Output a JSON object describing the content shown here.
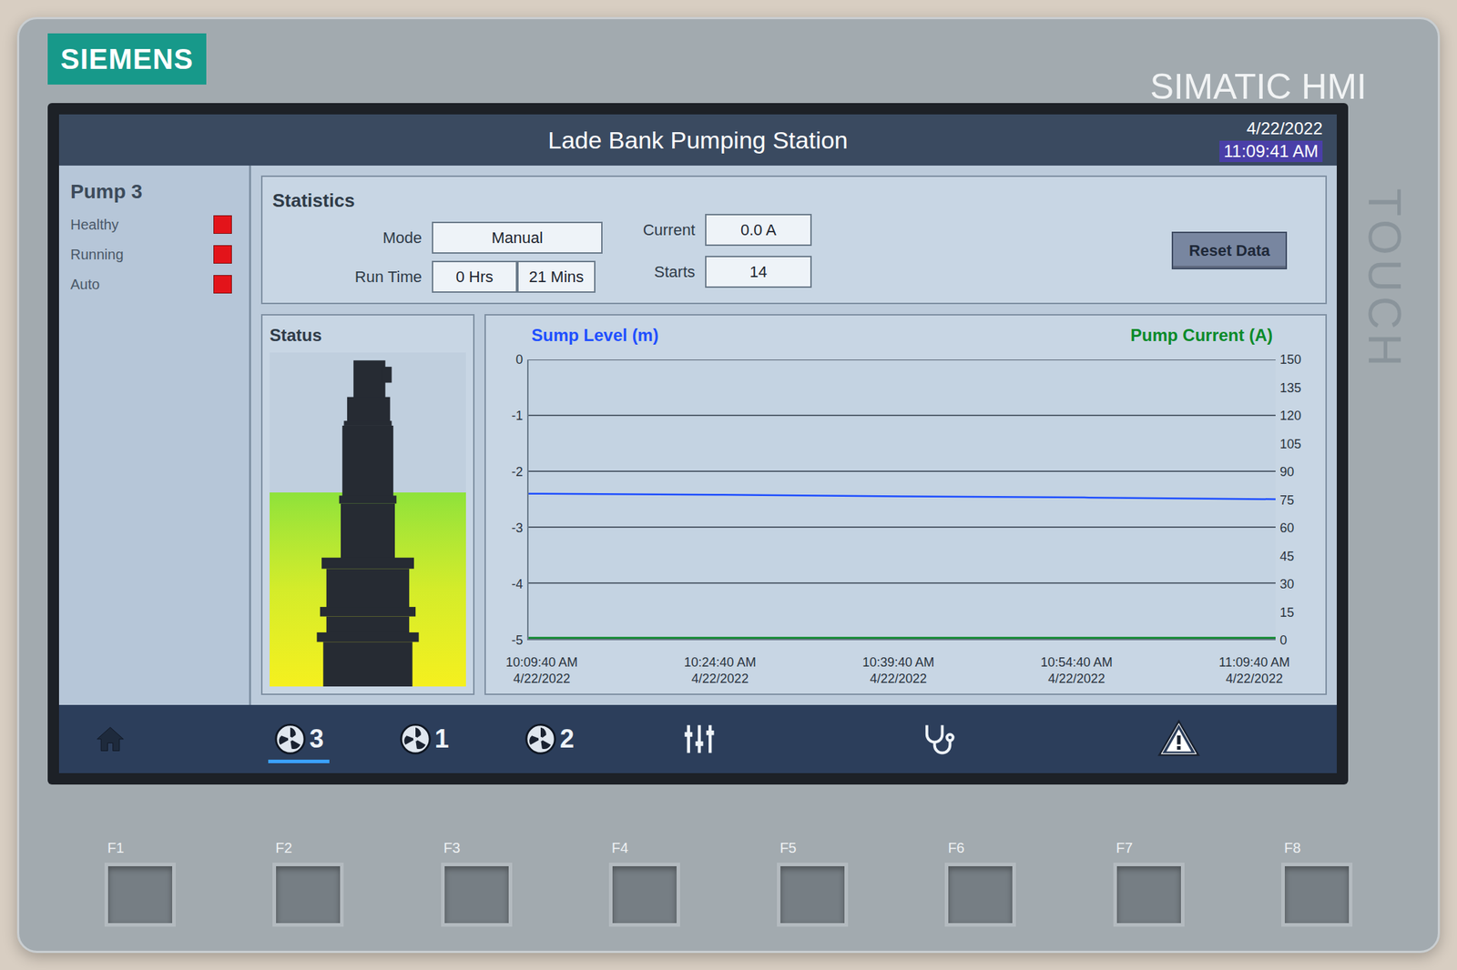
{
  "device": {
    "brand": "SIEMENS",
    "model": "SIMATIC HMI",
    "edge_label": "TOUCH"
  },
  "screen": {
    "title": "Lade Bank Pumping Station",
    "date": "4/22/2022",
    "time": "11:09:41 AM",
    "sidebar": {
      "title": "Pump 3",
      "indicators": [
        {
          "label": "Healthy",
          "on": false
        },
        {
          "label": "Running",
          "on": false
        },
        {
          "label": "Auto",
          "on": false
        }
      ]
    },
    "statistics": {
      "title": "Statistics",
      "mode": {
        "label": "Mode",
        "value": "Manual"
      },
      "run_time": {
        "label": "Run Time",
        "hours": "0 Hrs",
        "minutes": "21 Mins"
      },
      "current": {
        "label": "Current",
        "value": "0.0 A"
      },
      "starts": {
        "label": "Starts",
        "value": "14"
      },
      "reset_button": "Reset Data"
    },
    "status": {
      "title": "Status",
      "level": 0.58
    },
    "chart": {
      "left_axis": {
        "title": "Sump Level (m)",
        "ticks": [
          "0",
          "-1",
          "-2",
          "-3",
          "-4",
          "-5"
        ]
      },
      "right_axis": {
        "title": "Pump Current (A)",
        "ticks": [
          "150",
          "135",
          "120",
          "105",
          "90",
          "75",
          "60",
          "45",
          "30",
          "15",
          "0"
        ]
      },
      "x_ticks": [
        {
          "time": "10:09:40 AM",
          "date": "4/22/2022"
        },
        {
          "time": "10:24:40 AM",
          "date": "4/22/2022"
        },
        {
          "time": "10:39:40 AM",
          "date": "4/22/2022"
        },
        {
          "time": "10:54:40 AM",
          "date": "4/22/2022"
        },
        {
          "time": "11:09:40 AM",
          "date": "4/22/2022"
        }
      ],
      "series": [
        {
          "axis": "left",
          "color": "#1f4fff",
          "values": [
            -2.4,
            -2.42,
            -2.45,
            -2.47,
            -2.5
          ]
        },
        {
          "axis": "right",
          "color": "#0a8a2a",
          "values": [
            0,
            0,
            0,
            0,
            0
          ]
        }
      ]
    },
    "tabs": [
      {
        "label": "3",
        "selected": true
      },
      {
        "label": "1",
        "selected": false
      },
      {
        "label": "2",
        "selected": false
      }
    ]
  },
  "function_keys": [
    "F1",
    "F2",
    "F3",
    "F4",
    "F5",
    "F6",
    "F7",
    "F8"
  ]
}
